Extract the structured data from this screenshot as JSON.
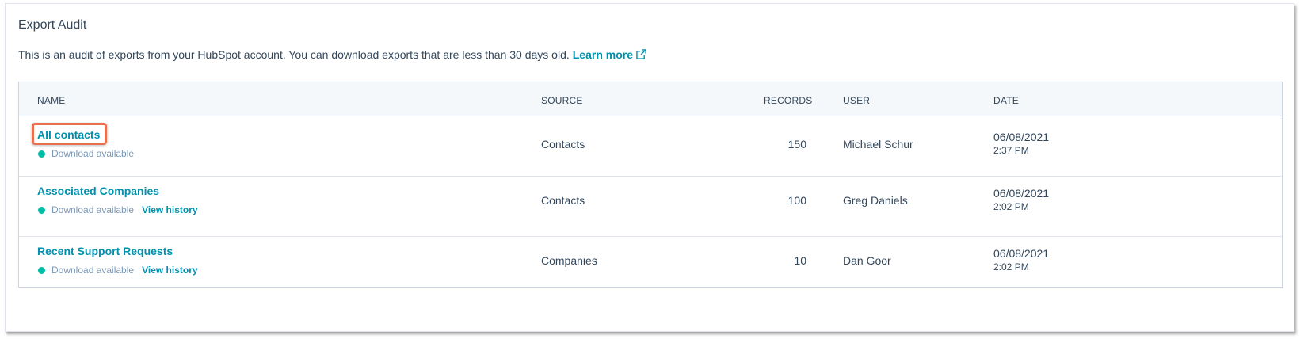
{
  "section": {
    "title": "Export Audit",
    "description": "This is an audit of exports from your HubSpot account. You can download exports that are less than 30 days old.",
    "learn_more": "Learn more"
  },
  "table": {
    "headers": {
      "name": "NAME",
      "source": "SOURCE",
      "records": "RECORDS",
      "user": "USER",
      "date": "DATE"
    },
    "rows": [
      {
        "name": "All contacts",
        "status": "Download available",
        "history": "",
        "source": "Contacts",
        "records": "150",
        "user": "Michael Schur",
        "date": "06/08/2021",
        "time": "2:37 PM"
      },
      {
        "name": "Associated Companies",
        "status": "Download available",
        "history": "View history",
        "source": "Contacts",
        "records": "100",
        "user": "Greg Daniels",
        "date": "06/08/2021",
        "time": "2:02 PM"
      },
      {
        "name": "Recent Support Requests",
        "status": "Download available",
        "history": "View history",
        "source": "Companies",
        "records": "10",
        "user": "Dan Goor",
        "date": "06/08/2021",
        "time": "2:02 PM"
      }
    ]
  },
  "colors": {
    "link": "#0091ae",
    "text": "#33475b",
    "status_dot": "#00bda5",
    "highlight": "#e8704f",
    "header_bg": "#f5f8fa"
  },
  "icons": {
    "external_link": "external-link-icon",
    "status": "status-dot-icon"
  }
}
